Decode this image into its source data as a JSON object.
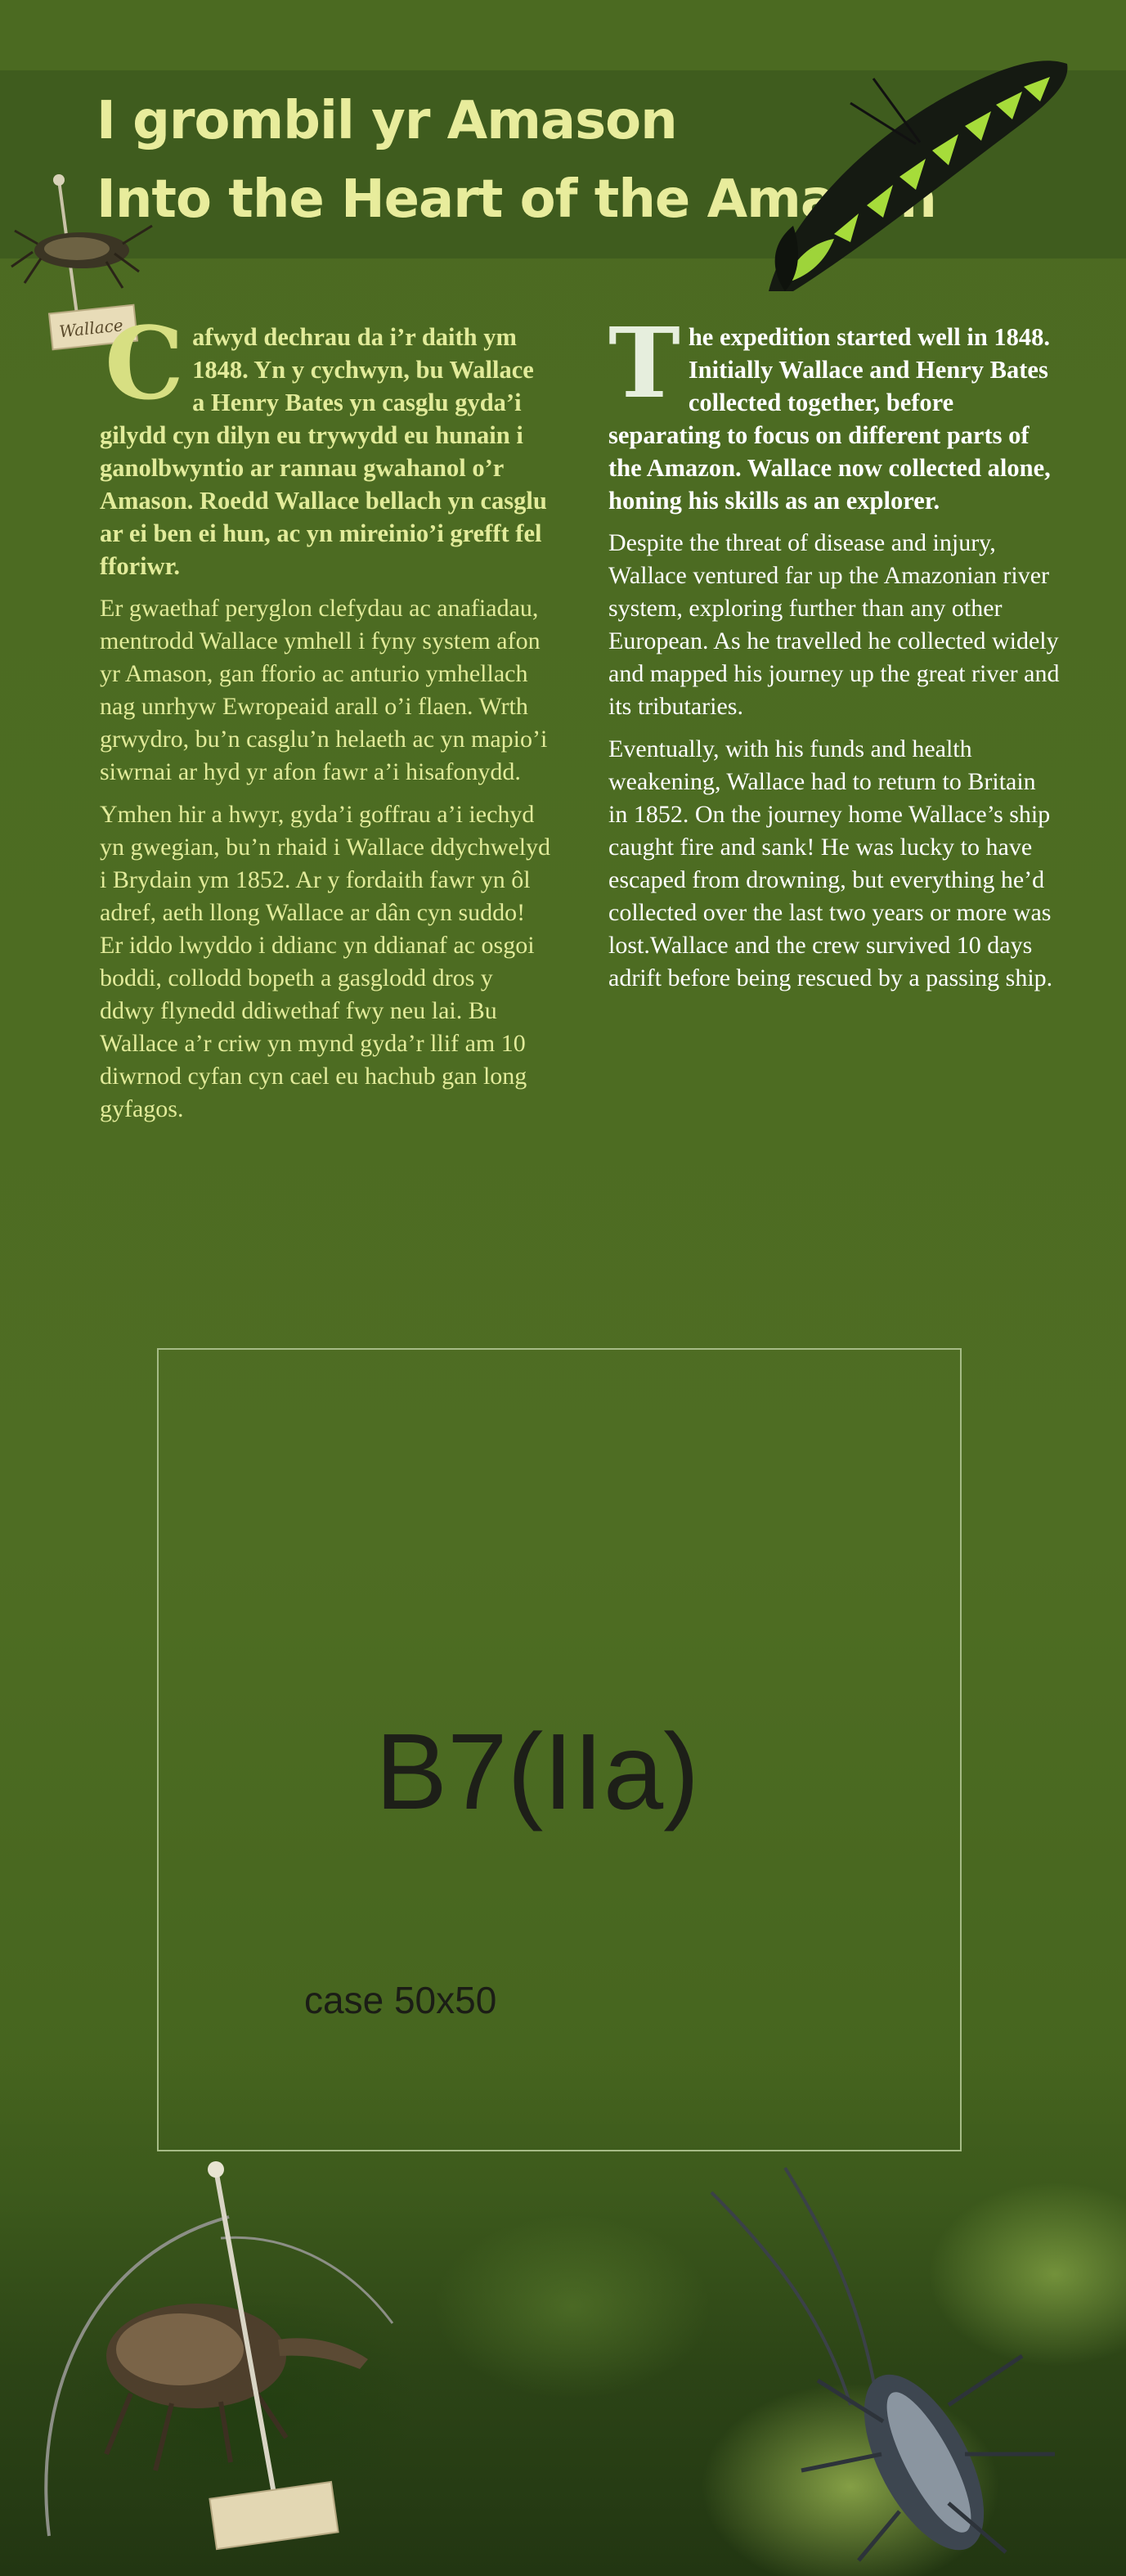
{
  "header": {
    "title_cy": "I grombil yr Amason",
    "title_en": "Into the Heart of the Amazon"
  },
  "specimen_label": {
    "tag_text": "Wallace"
  },
  "welsh": {
    "lead_dropcap": "C",
    "lead_rest": "afwyd dechrau da i’r daith ym 1848. Yn y cychwyn, bu Wallace a Henry Bates yn casglu gyda’i gilydd cyn dilyn eu trywydd eu hunain i ganolbwyntio ar rannau gwahanol o’r Amason. Roedd Wallace bellach yn casglu ar ei ben ei hun, ac yn mireinio’i grefft fel fforiwr.",
    "paragraphs": [
      "Er gwaethaf peryglon clefydau ac anafiadau, mentrodd Wallace ymhell i fyny system afon yr Amason, gan fforio ac anturio ymhellach nag unrhyw Ewropeaid arall o’i flaen. Wrth grwydro, bu’n casglu’n helaeth ac yn mapio’i siwrnai ar hyd yr afon fawr a’i hisafonydd.",
      "Ymhen hir a hwyr, gyda’i goffrau a’i iechyd yn gwegian, bu’n rhaid i Wallace ddychwelyd i Brydain ym 1852. Ar y fordaith fawr yn ôl adref, aeth llong Wallace ar dân cyn suddo! Er iddo lwyddo i ddianc yn ddianaf ac osgoi boddi, collodd bopeth a gasglodd dros y ddwy flynedd ddiwethaf fwy neu lai. Bu Wallace a’r criw yn mynd gyda’r llif am 10 diwrnod cyfan cyn cael eu hachub gan long gyfagos."
    ]
  },
  "english": {
    "lead_dropcap": "T",
    "lead_rest": "he expedition started well in 1848. Initially Wallace and Henry Bates collected together, before separating to focus on different parts of the Amazon. Wallace now collected alone, honing his skills as an explorer.",
    "paragraphs": [
      "Despite the threat of disease and injury, Wallace ventured far up the Amazonian river system, exploring further than any other European. As he travelled he collected widely and mapped his journey up the great river and its tributaries.",
      "Eventually, with his funds and health weakening, Wallace had to return to Britain in 1852. On the journey home Wallace’s ship caught fire and sank! He was lucky to have escaped from drowning, but everything he’d collected over the last two years or more was lost.Wallace and the crew survived 10 days adrift before being rescued by a passing ship."
    ]
  },
  "display_case": {
    "code": "B7(IIa)",
    "size_label": "case 50x50"
  },
  "colors": {
    "background": "#4c6a22",
    "header_band": "#3f5c1e",
    "welsh_text": "#e2eb9a",
    "english_text": "#ffffff",
    "title": "#e8ec9c",
    "butterfly_green": "#9ed43a"
  }
}
